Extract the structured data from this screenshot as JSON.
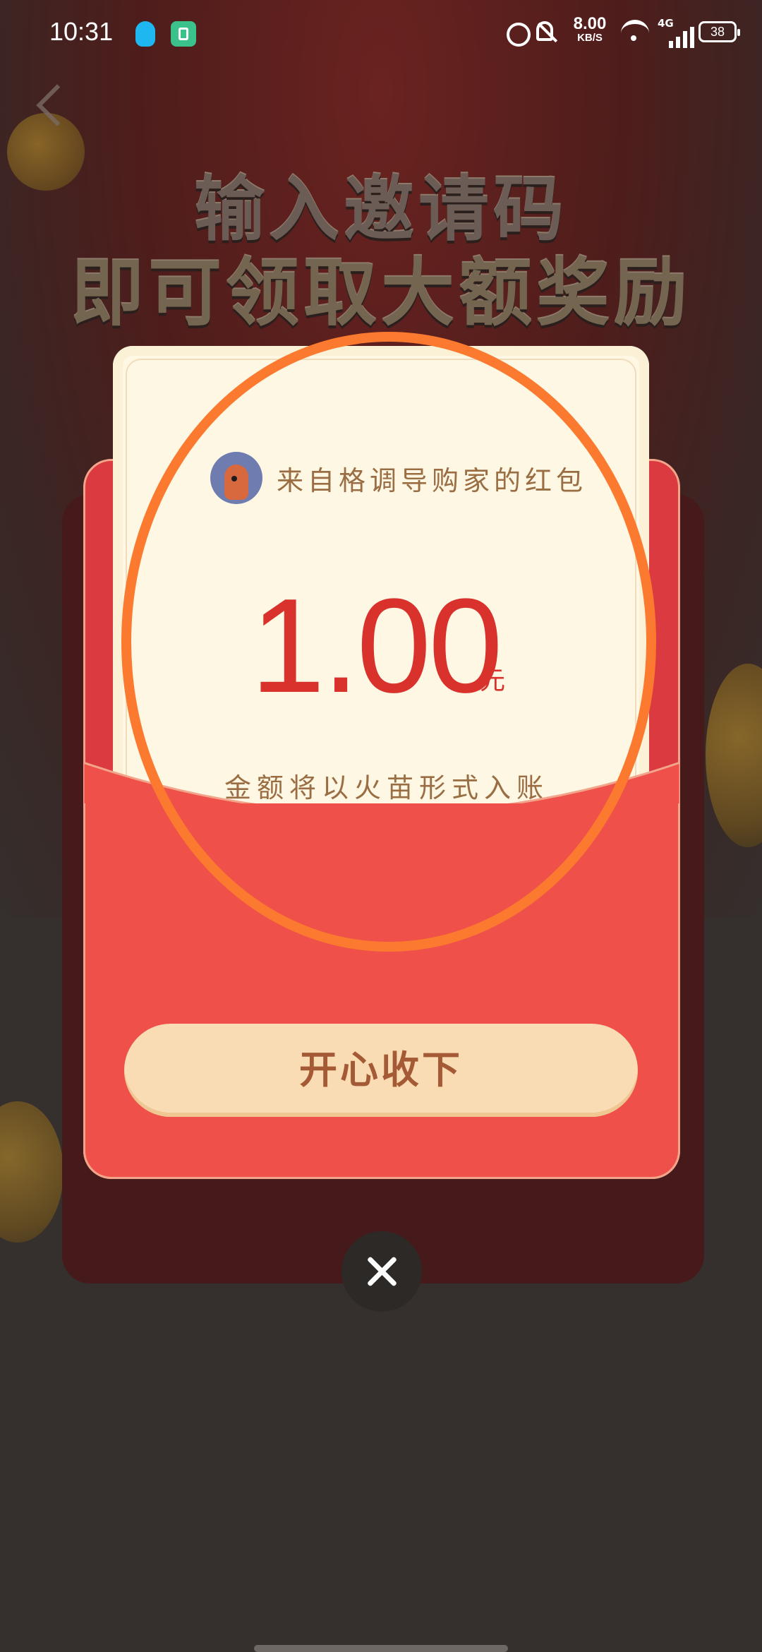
{
  "status_bar": {
    "time": "10:31",
    "speed_value": "8.00",
    "speed_unit": "KB/S",
    "network": "4G",
    "battery": "38",
    "icons": [
      "qq-icon",
      "app-icon",
      "alarm-icon",
      "mute-icon",
      "wifi-icon",
      "signal-icon",
      "battery-icon"
    ]
  },
  "background": {
    "headline_line1": "输入邀请码",
    "headline_line2": "即可领取大额奖励"
  },
  "red_packet": {
    "from_text": "来自格调导购家的红包",
    "amount": "1.00",
    "unit": "元",
    "note": "金额将以火苗形式入账",
    "collect_label": "开心收下"
  },
  "colors": {
    "envelope_red": "#ef504a",
    "amount_red": "#d9322c",
    "button_bg": "#f9dcb3",
    "annotation": "#fb7a2f"
  }
}
